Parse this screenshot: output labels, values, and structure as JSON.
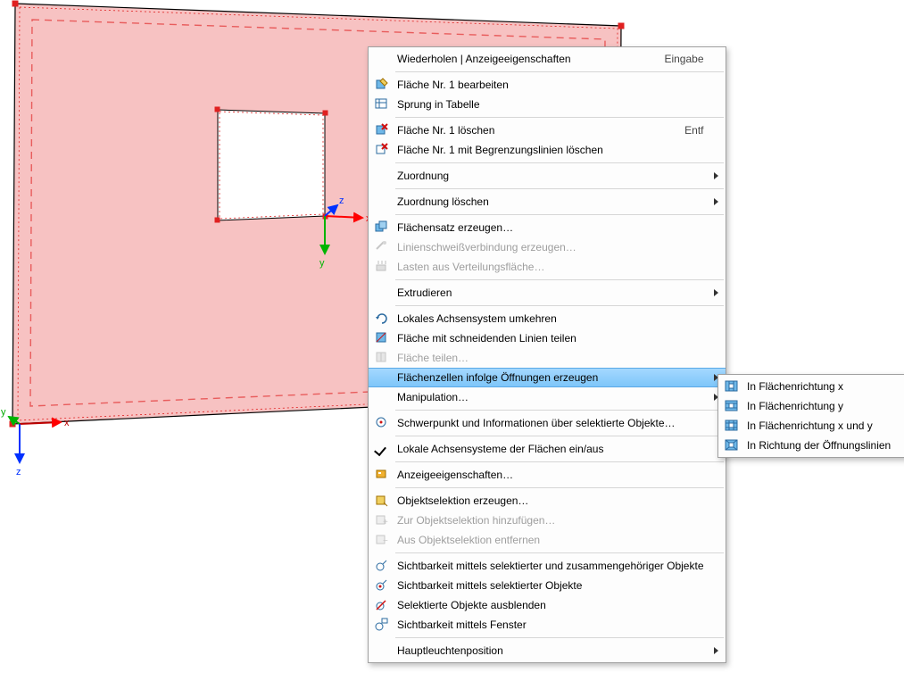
{
  "viewport": {
    "axis_labels": {
      "x": "x",
      "y": "y",
      "z": "z"
    },
    "local_axis_labels": {
      "x": "x",
      "y": "y",
      "z": "z"
    }
  },
  "menu": {
    "repeat": "Wiederholen | Anzeigeeigenschaften",
    "repeat_shortcut": "Eingabe",
    "edit_surface": "Fläche Nr. 1 bearbeiten",
    "jump_to_table": "Sprung in Tabelle",
    "delete_surface": "Fläche Nr. 1 löschen",
    "delete_surface_shortcut": "Entf",
    "delete_surface_with_lines": "Fläche Nr. 1 mit Begrenzungslinien löschen",
    "assign": "Zuordnung",
    "delete_assign": "Zuordnung löschen",
    "create_surface_set": "Flächensatz erzeugen…",
    "create_line_weld": "Linienschweißverbindung erzeugen…",
    "loads_from_area": "Lasten aus Verteilungsfläche…",
    "extrude": "Extrudieren",
    "reverse_local": "Lokales Achsensystem umkehren",
    "split_surface_intersect": "Fläche mit schneidenden Linien teilen",
    "divide_surface": "Fläche teilen…",
    "create_cells": "Flächenzellen infolge Öffnungen erzeugen",
    "manipulation": "Manipulation…",
    "centroid_info": "Schwerpunkt und Informationen über selektierte Objekte…",
    "toggle_local_axes": "Lokale Achsensysteme der Flächen ein/aus",
    "display_props": "Anzeigeeigenschaften…",
    "create_obj_selection": "Objektselektion erzeugen…",
    "add_to_obj_selection": "Zur Objektselektion hinzufügen…",
    "remove_from_obj_selection": "Aus Objektselektion entfernen",
    "visibility_related": "Sichtbarkeit mittels selektierter und zusammengehöriger Objekte",
    "visibility_selected": "Sichtbarkeit mittels selektierter Objekte",
    "hide_selected": "Selektierte Objekte ausblenden",
    "visibility_window": "Sichtbarkeit mittels Fenster",
    "main_light": "Hauptleuchtenposition"
  },
  "submenu": {
    "dir_x": "In Flächenrichtung x",
    "dir_y": "In Flächenrichtung y",
    "dir_xy": "In Flächenrichtung x und y",
    "dir_opening_lines": "In Richtung der Öffnungslinien"
  }
}
